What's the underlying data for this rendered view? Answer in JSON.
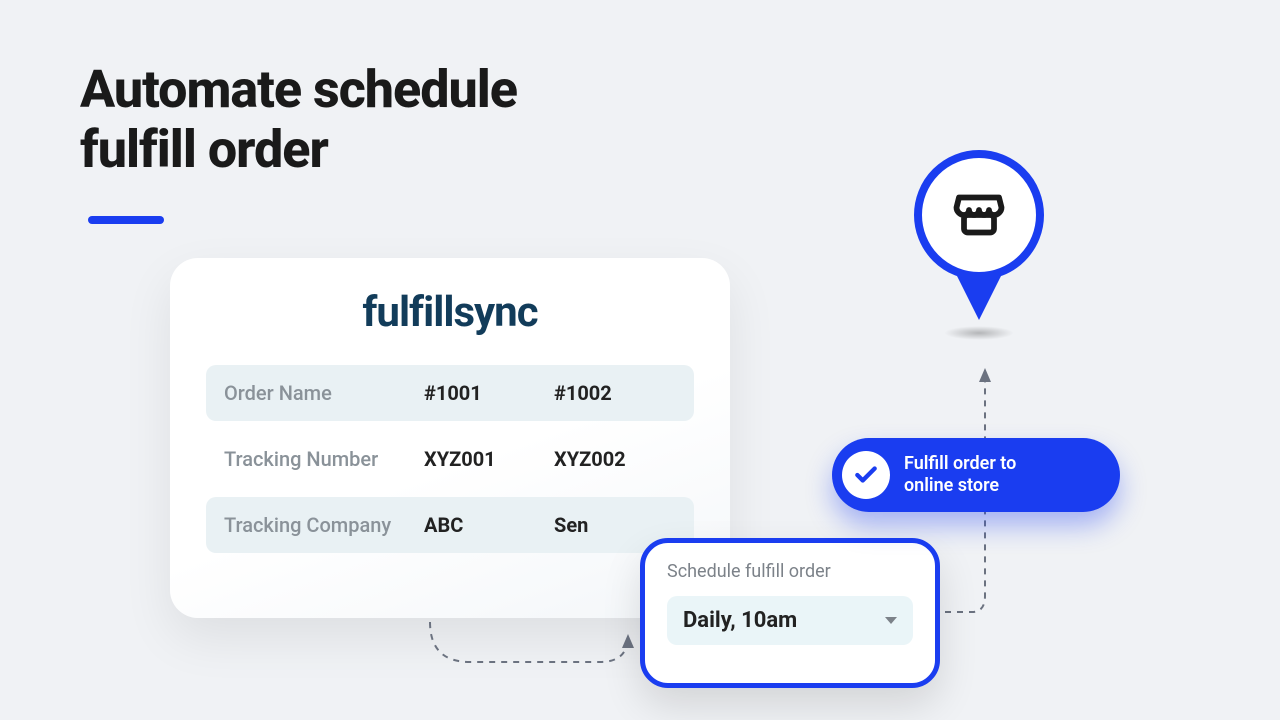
{
  "heading": "Automate schedule\nfulfill order",
  "brand": "fulfillsync",
  "rows": [
    {
      "label": "Order Name",
      "v1": "#1001",
      "v2": "#1002"
    },
    {
      "label": "Tracking Number",
      "v1": "XYZ001",
      "v2": "XYZ002"
    },
    {
      "label": "Tracking Company",
      "v1": "ABC",
      "v2": "Sen"
    }
  ],
  "schedule": {
    "label": "Schedule fulfill order",
    "value": "Daily, 10am"
  },
  "pill": "Fulfill order to\nonline store",
  "colors": {
    "accent": "#1a3df0"
  }
}
